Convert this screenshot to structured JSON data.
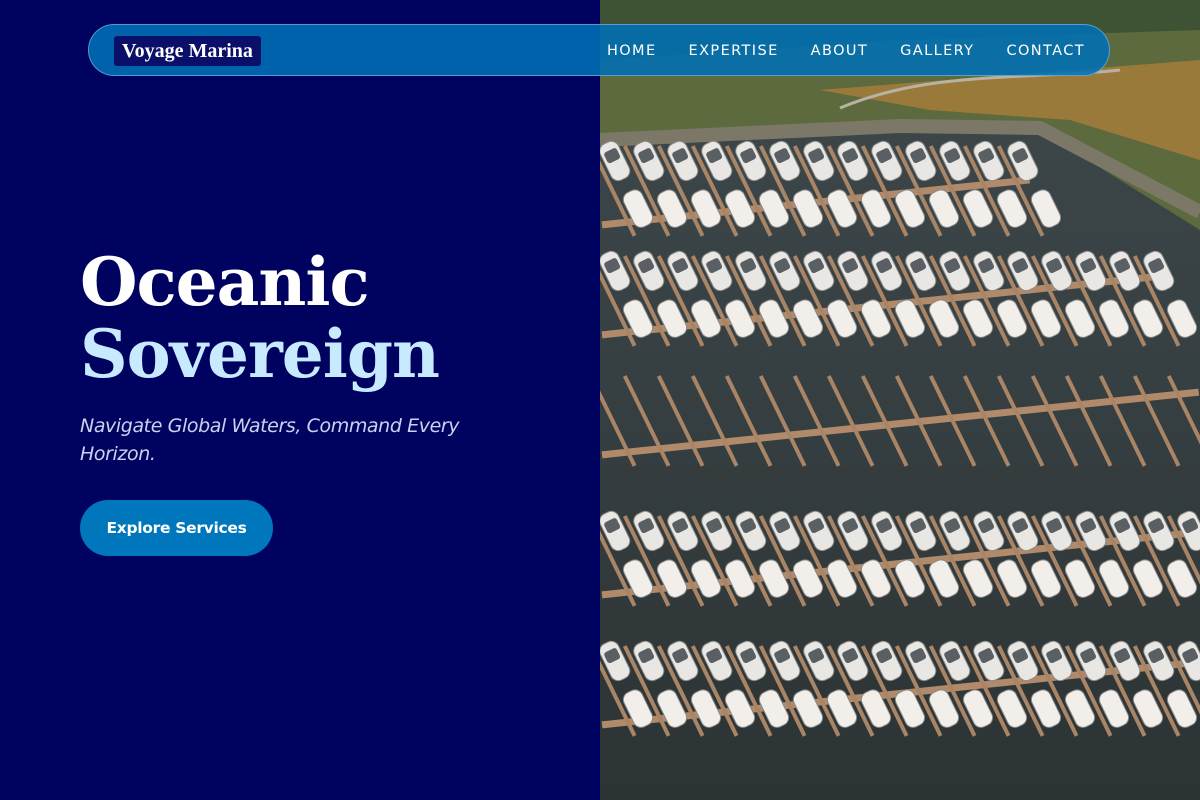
{
  "brand": {
    "name": "Voyage Marina"
  },
  "nav": {
    "items": [
      "HOME",
      "EXPERTISE",
      "ABOUT",
      "GALLERY",
      "CONTACT"
    ]
  },
  "hero": {
    "title_line1": "Oceanic",
    "title_line2": "Sovereign",
    "tagline": "Navigate Global Waters, Command Every Horizon.",
    "cta_label": "Explore Services"
  },
  "image": {
    "subject": "aerial view of a marina with rows of docked yachts"
  },
  "colors": {
    "background": "#000260",
    "accent": "#0077bd",
    "title_accent": "#c7eaff"
  }
}
